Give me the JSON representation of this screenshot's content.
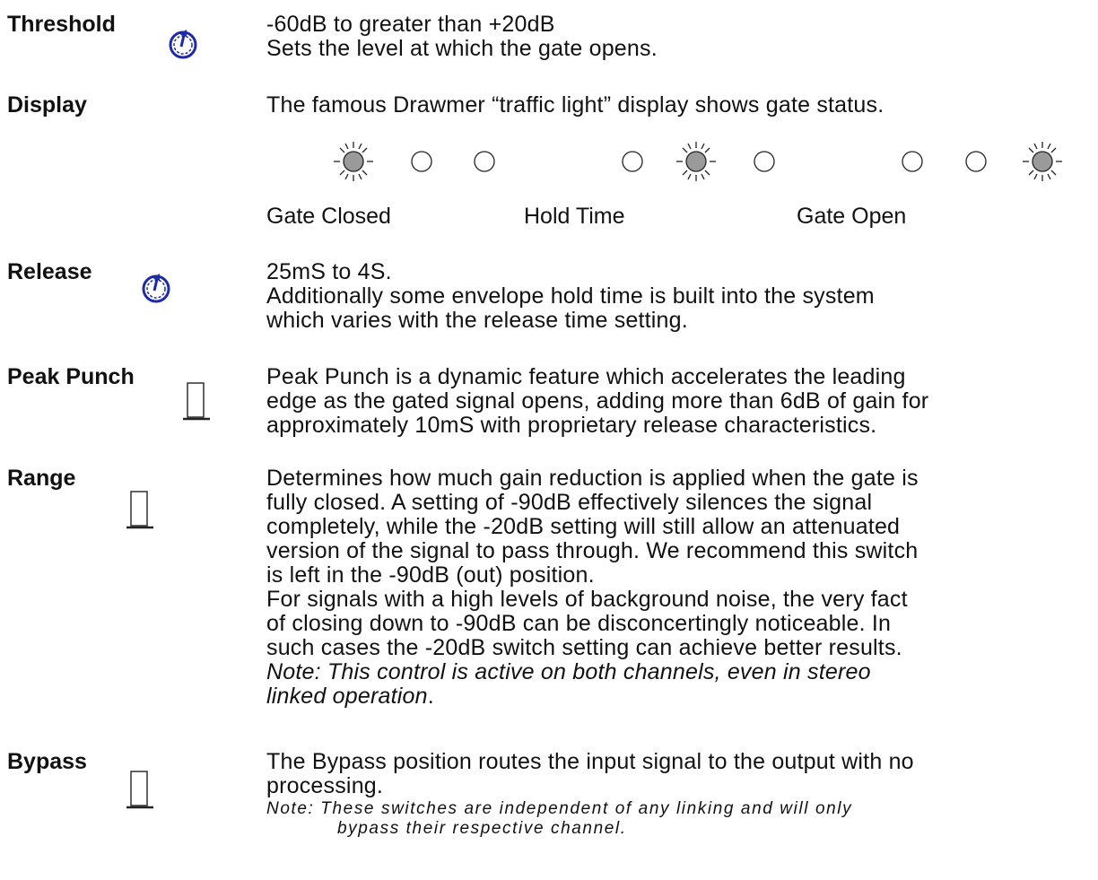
{
  "sections": {
    "threshold": {
      "label": "Threshold",
      "control": "knob-icon",
      "lines": [
        "-60dB to greater than +20dB",
        "Sets the level at which the gate opens."
      ]
    },
    "display": {
      "label": "Display",
      "lines": [
        "The famous Drawmer “traffic light” display shows gate status."
      ],
      "states": [
        {
          "caption": "Gate Closed",
          "lit": 1
        },
        {
          "caption": "Hold Time",
          "lit": 2
        },
        {
          "caption": "Gate Open",
          "lit": 3
        }
      ]
    },
    "release": {
      "label": "Release",
      "control": "knob-icon",
      "lines": [
        "25mS to 4S.",
        "Additionally  some envelope hold time is built into the system",
        "which varies with the release time setting."
      ]
    },
    "peak_punch": {
      "label": "Peak Punch",
      "control": "switch-icon",
      "lines": [
        "Peak Punch is a dynamic feature which accelerates the leading",
        "edge as the gated signal opens, adding more than 6dB of gain for",
        "approximately 10mS with proprietary release characteristics."
      ]
    },
    "range": {
      "label": "Range",
      "control": "switch-icon",
      "lines": [
        "Determines how much gain reduction is applied when the gate is",
        "fully closed. A setting of -90dB effectively silences the signal",
        "completely, while the -20dB setting will still allow an attenuated",
        "version of the signal to pass through.  We recommend this switch",
        "is left in the -90dB (out) position.",
        "For signals with a high levels of background noise, the very fact",
        "of closing down to -90dB can be disconcertingly noticeable. In",
        "such cases the -20dB switch setting can achieve better results."
      ],
      "note_lines": [
        "Note:  This control is active on both channels, even in stereo",
        "linked operation"
      ],
      "note_tail": "."
    },
    "bypass": {
      "label": "Bypass",
      "control": "switch-icon",
      "lines": [
        "The Bypass position routes the input signal to the output with no",
        "processing."
      ],
      "note_lines": [
        "Note:   These switches are independent of any linking and will only",
        "bypass their respective channel."
      ]
    }
  },
  "colors": {
    "text": "#111111",
    "knob": "#1f2aa8",
    "lamp_lit": "#9a9a9a",
    "lamp_off": "#ffffff"
  }
}
